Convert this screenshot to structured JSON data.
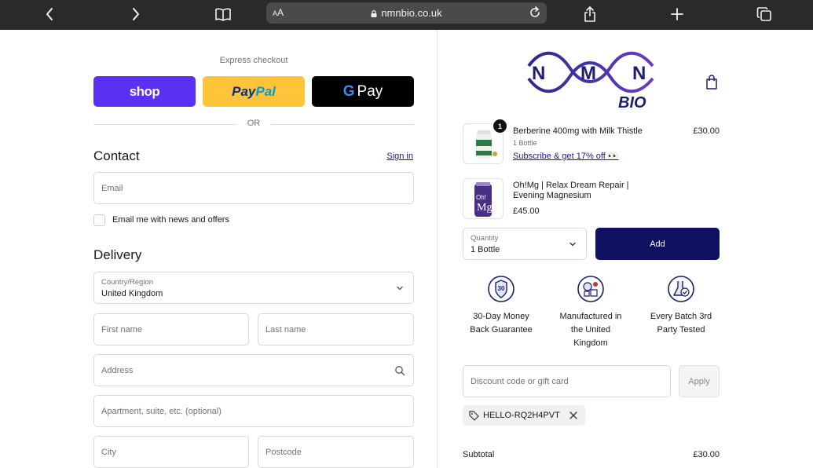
{
  "browser": {
    "url_text": "nmnbio.co.uk",
    "reader_label_small": "A",
    "reader_label_big": "A"
  },
  "checkout": {
    "express_label": "Express checkout",
    "shop_label": "shop",
    "paypal_label_1": "Pay",
    "paypal_label_2": "Pal",
    "gpay_g": "G",
    "gpay_label": "Pay",
    "or_label": "OR",
    "contact_heading": "Contact",
    "signin_label": "Sign in",
    "email_placeholder": "Email",
    "newsletter_label": "Email me with news and offers",
    "delivery_heading": "Delivery",
    "country_label": "Country/Region",
    "country_value": "United Kingdom",
    "first_name_placeholder": "First name",
    "last_name_placeholder": "Last name",
    "address_placeholder": "Address",
    "apartment_placeholder": "Apartment, suite, etc. (optional)",
    "city_placeholder": "City",
    "postcode_placeholder": "Postcode"
  },
  "summary": {
    "logo_text_n1": "N",
    "logo_text_m": "M",
    "logo_text_n2": "N",
    "logo_text_bio": "BIO",
    "items": [
      {
        "name": "Berberine 400mg with Milk Thistle",
        "variant": "1 Bottle",
        "link": "Subscribe & get 17% off 👀",
        "price": "£30.00",
        "quantity": "1"
      }
    ],
    "upsell": {
      "name_line1": "Oh!Mg | Relax Dream Repair |",
      "name_line2": "Evening Magnesium",
      "price": "£45.00",
      "quantity_label": "Quantity",
      "quantity_value": "1 Bottle",
      "add_label": "Add"
    },
    "badges": [
      {
        "line1": "30-Day Money",
        "line2": "Back Guarantee",
        "line3": ""
      },
      {
        "line1": "Manufactured in",
        "line2": "the United",
        "line3": "Kingdom"
      },
      {
        "line1": "Every Batch 3rd",
        "line2": "Party Tested",
        "line3": ""
      }
    ],
    "discount_placeholder": "Discount code or gift card",
    "apply_label": "Apply",
    "applied_code": "HELLO-RQ2H4PVT",
    "subtotal_label": "Subtotal",
    "subtotal_value": "£30.00"
  },
  "colors": {
    "shop_purple": "#5a31f4",
    "paypal_yellow": "#ffc439",
    "brand_navy": "#101060",
    "link_blue": "#1a1a8a"
  }
}
